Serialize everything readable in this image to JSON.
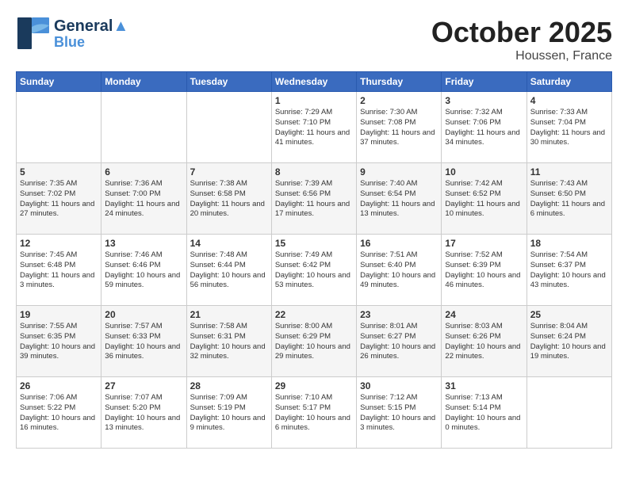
{
  "header": {
    "logo_line1": "General",
    "logo_line2": "Blue",
    "month": "October 2025",
    "location": "Houssen, France"
  },
  "days_of_week": [
    "Sunday",
    "Monday",
    "Tuesday",
    "Wednesday",
    "Thursday",
    "Friday",
    "Saturday"
  ],
  "weeks": [
    [
      {
        "day": "",
        "content": ""
      },
      {
        "day": "",
        "content": ""
      },
      {
        "day": "",
        "content": ""
      },
      {
        "day": "1",
        "content": "Sunrise: 7:29 AM\nSunset: 7:10 PM\nDaylight: 11 hours and 41 minutes."
      },
      {
        "day": "2",
        "content": "Sunrise: 7:30 AM\nSunset: 7:08 PM\nDaylight: 11 hours and 37 minutes."
      },
      {
        "day": "3",
        "content": "Sunrise: 7:32 AM\nSunset: 7:06 PM\nDaylight: 11 hours and 34 minutes."
      },
      {
        "day": "4",
        "content": "Sunrise: 7:33 AM\nSunset: 7:04 PM\nDaylight: 11 hours and 30 minutes."
      }
    ],
    [
      {
        "day": "5",
        "content": "Sunrise: 7:35 AM\nSunset: 7:02 PM\nDaylight: 11 hours and 27 minutes."
      },
      {
        "day": "6",
        "content": "Sunrise: 7:36 AM\nSunset: 7:00 PM\nDaylight: 11 hours and 24 minutes."
      },
      {
        "day": "7",
        "content": "Sunrise: 7:38 AM\nSunset: 6:58 PM\nDaylight: 11 hours and 20 minutes."
      },
      {
        "day": "8",
        "content": "Sunrise: 7:39 AM\nSunset: 6:56 PM\nDaylight: 11 hours and 17 minutes."
      },
      {
        "day": "9",
        "content": "Sunrise: 7:40 AM\nSunset: 6:54 PM\nDaylight: 11 hours and 13 minutes."
      },
      {
        "day": "10",
        "content": "Sunrise: 7:42 AM\nSunset: 6:52 PM\nDaylight: 11 hours and 10 minutes."
      },
      {
        "day": "11",
        "content": "Sunrise: 7:43 AM\nSunset: 6:50 PM\nDaylight: 11 hours and 6 minutes."
      }
    ],
    [
      {
        "day": "12",
        "content": "Sunrise: 7:45 AM\nSunset: 6:48 PM\nDaylight: 11 hours and 3 minutes."
      },
      {
        "day": "13",
        "content": "Sunrise: 7:46 AM\nSunset: 6:46 PM\nDaylight: 10 hours and 59 minutes."
      },
      {
        "day": "14",
        "content": "Sunrise: 7:48 AM\nSunset: 6:44 PM\nDaylight: 10 hours and 56 minutes."
      },
      {
        "day": "15",
        "content": "Sunrise: 7:49 AM\nSunset: 6:42 PM\nDaylight: 10 hours and 53 minutes."
      },
      {
        "day": "16",
        "content": "Sunrise: 7:51 AM\nSunset: 6:40 PM\nDaylight: 10 hours and 49 minutes."
      },
      {
        "day": "17",
        "content": "Sunrise: 7:52 AM\nSunset: 6:39 PM\nDaylight: 10 hours and 46 minutes."
      },
      {
        "day": "18",
        "content": "Sunrise: 7:54 AM\nSunset: 6:37 PM\nDaylight: 10 hours and 43 minutes."
      }
    ],
    [
      {
        "day": "19",
        "content": "Sunrise: 7:55 AM\nSunset: 6:35 PM\nDaylight: 10 hours and 39 minutes."
      },
      {
        "day": "20",
        "content": "Sunrise: 7:57 AM\nSunset: 6:33 PM\nDaylight: 10 hours and 36 minutes."
      },
      {
        "day": "21",
        "content": "Sunrise: 7:58 AM\nSunset: 6:31 PM\nDaylight: 10 hours and 32 minutes."
      },
      {
        "day": "22",
        "content": "Sunrise: 8:00 AM\nSunset: 6:29 PM\nDaylight: 10 hours and 29 minutes."
      },
      {
        "day": "23",
        "content": "Sunrise: 8:01 AM\nSunset: 6:27 PM\nDaylight: 10 hours and 26 minutes."
      },
      {
        "day": "24",
        "content": "Sunrise: 8:03 AM\nSunset: 6:26 PM\nDaylight: 10 hours and 22 minutes."
      },
      {
        "day": "25",
        "content": "Sunrise: 8:04 AM\nSunset: 6:24 PM\nDaylight: 10 hours and 19 minutes."
      }
    ],
    [
      {
        "day": "26",
        "content": "Sunrise: 7:06 AM\nSunset: 5:22 PM\nDaylight: 10 hours and 16 minutes."
      },
      {
        "day": "27",
        "content": "Sunrise: 7:07 AM\nSunset: 5:20 PM\nDaylight: 10 hours and 13 minutes."
      },
      {
        "day": "28",
        "content": "Sunrise: 7:09 AM\nSunset: 5:19 PM\nDaylight: 10 hours and 9 minutes."
      },
      {
        "day": "29",
        "content": "Sunrise: 7:10 AM\nSunset: 5:17 PM\nDaylight: 10 hours and 6 minutes."
      },
      {
        "day": "30",
        "content": "Sunrise: 7:12 AM\nSunset: 5:15 PM\nDaylight: 10 hours and 3 minutes."
      },
      {
        "day": "31",
        "content": "Sunrise: 7:13 AM\nSunset: 5:14 PM\nDaylight: 10 hours and 0 minutes."
      },
      {
        "day": "",
        "content": ""
      }
    ]
  ]
}
